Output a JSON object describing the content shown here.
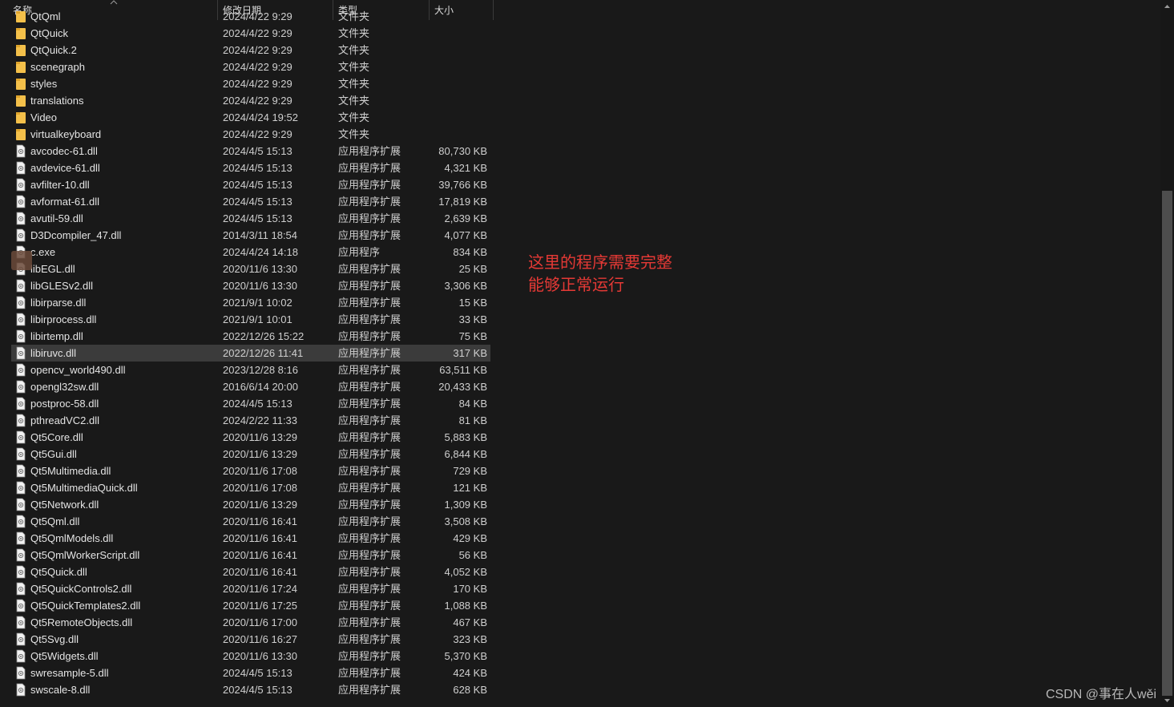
{
  "header": {
    "name": "名称",
    "date": "修改日期",
    "type": "类型",
    "size": "大小"
  },
  "rows": [
    {
      "name": "QtQml",
      "date": "2024/4/22 9:29",
      "type": "文件夹",
      "size": "",
      "kind": "folder"
    },
    {
      "name": "QtQuick",
      "date": "2024/4/22 9:29",
      "type": "文件夹",
      "size": "",
      "kind": "folder"
    },
    {
      "name": "QtQuick.2",
      "date": "2024/4/22 9:29",
      "type": "文件夹",
      "size": "",
      "kind": "folder"
    },
    {
      "name": "scenegraph",
      "date": "2024/4/22 9:29",
      "type": "文件夹",
      "size": "",
      "kind": "folder"
    },
    {
      "name": "styles",
      "date": "2024/4/22 9:29",
      "type": "文件夹",
      "size": "",
      "kind": "folder"
    },
    {
      "name": "translations",
      "date": "2024/4/22 9:29",
      "type": "文件夹",
      "size": "",
      "kind": "folder"
    },
    {
      "name": "Video",
      "date": "2024/4/24 19:52",
      "type": "文件夹",
      "size": "",
      "kind": "folder"
    },
    {
      "name": "virtualkeyboard",
      "date": "2024/4/22 9:29",
      "type": "文件夹",
      "size": "",
      "kind": "folder"
    },
    {
      "name": "avcodec-61.dll",
      "date": "2024/4/5 15:13",
      "type": "应用程序扩展",
      "size": "80,730 KB",
      "kind": "dll"
    },
    {
      "name": "avdevice-61.dll",
      "date": "2024/4/5 15:13",
      "type": "应用程序扩展",
      "size": "4,321 KB",
      "kind": "dll"
    },
    {
      "name": "avfilter-10.dll",
      "date": "2024/4/5 15:13",
      "type": "应用程序扩展",
      "size": "39,766 KB",
      "kind": "dll"
    },
    {
      "name": "avformat-61.dll",
      "date": "2024/4/5 15:13",
      "type": "应用程序扩展",
      "size": "17,819 KB",
      "kind": "dll"
    },
    {
      "name": "avutil-59.dll",
      "date": "2024/4/5 15:13",
      "type": "应用程序扩展",
      "size": "2,639 KB",
      "kind": "dll"
    },
    {
      "name": "D3Dcompiler_47.dll",
      "date": "2014/3/11 18:54",
      "type": "应用程序扩展",
      "size": "4,077 KB",
      "kind": "dll"
    },
    {
      "name": "c.exe",
      "date": "2024/4/24 14:18",
      "type": "应用程序",
      "size": "834 KB",
      "kind": "exe"
    },
    {
      "name": "libEGL.dll",
      "date": "2020/11/6 13:30",
      "type": "应用程序扩展",
      "size": "25 KB",
      "kind": "dll"
    },
    {
      "name": "libGLESv2.dll",
      "date": "2020/11/6 13:30",
      "type": "应用程序扩展",
      "size": "3,306 KB",
      "kind": "dll"
    },
    {
      "name": "libirparse.dll",
      "date": "2021/9/1 10:02",
      "type": "应用程序扩展",
      "size": "15 KB",
      "kind": "dll"
    },
    {
      "name": "libirprocess.dll",
      "date": "2021/9/1 10:01",
      "type": "应用程序扩展",
      "size": "33 KB",
      "kind": "dll"
    },
    {
      "name": "libirtemp.dll",
      "date": "2022/12/26 15:22",
      "type": "应用程序扩展",
      "size": "75 KB",
      "kind": "dll"
    },
    {
      "name": "libiruvc.dll",
      "date": "2022/12/26 11:41",
      "type": "应用程序扩展",
      "size": "317 KB",
      "kind": "dll",
      "selected": true
    },
    {
      "name": "opencv_world490.dll",
      "date": "2023/12/28 8:16",
      "type": "应用程序扩展",
      "size": "63,511 KB",
      "kind": "dll"
    },
    {
      "name": "opengl32sw.dll",
      "date": "2016/6/14 20:00",
      "type": "应用程序扩展",
      "size": "20,433 KB",
      "kind": "dll"
    },
    {
      "name": "postproc-58.dll",
      "date": "2024/4/5 15:13",
      "type": "应用程序扩展",
      "size": "84 KB",
      "kind": "dll"
    },
    {
      "name": "pthreadVC2.dll",
      "date": "2024/2/22 11:33",
      "type": "应用程序扩展",
      "size": "81 KB",
      "kind": "dll"
    },
    {
      "name": "Qt5Core.dll",
      "date": "2020/11/6 13:29",
      "type": "应用程序扩展",
      "size": "5,883 KB",
      "kind": "dll"
    },
    {
      "name": "Qt5Gui.dll",
      "date": "2020/11/6 13:29",
      "type": "应用程序扩展",
      "size": "6,844 KB",
      "kind": "dll"
    },
    {
      "name": "Qt5Multimedia.dll",
      "date": "2020/11/6 17:08",
      "type": "应用程序扩展",
      "size": "729 KB",
      "kind": "dll"
    },
    {
      "name": "Qt5MultimediaQuick.dll",
      "date": "2020/11/6 17:08",
      "type": "应用程序扩展",
      "size": "121 KB",
      "kind": "dll"
    },
    {
      "name": "Qt5Network.dll",
      "date": "2020/11/6 13:29",
      "type": "应用程序扩展",
      "size": "1,309 KB",
      "kind": "dll"
    },
    {
      "name": "Qt5Qml.dll",
      "date": "2020/11/6 16:41",
      "type": "应用程序扩展",
      "size": "3,508 KB",
      "kind": "dll"
    },
    {
      "name": "Qt5QmlModels.dll",
      "date": "2020/11/6 16:41",
      "type": "应用程序扩展",
      "size": "429 KB",
      "kind": "dll"
    },
    {
      "name": "Qt5QmlWorkerScript.dll",
      "date": "2020/11/6 16:41",
      "type": "应用程序扩展",
      "size": "56 KB",
      "kind": "dll"
    },
    {
      "name": "Qt5Quick.dll",
      "date": "2020/11/6 16:41",
      "type": "应用程序扩展",
      "size": "4,052 KB",
      "kind": "dll"
    },
    {
      "name": "Qt5QuickControls2.dll",
      "date": "2020/11/6 17:24",
      "type": "应用程序扩展",
      "size": "170 KB",
      "kind": "dll"
    },
    {
      "name": "Qt5QuickTemplates2.dll",
      "date": "2020/11/6 17:25",
      "type": "应用程序扩展",
      "size": "1,088 KB",
      "kind": "dll"
    },
    {
      "name": "Qt5RemoteObjects.dll",
      "date": "2020/11/6 17:00",
      "type": "应用程序扩展",
      "size": "467 KB",
      "kind": "dll"
    },
    {
      "name": "Qt5Svg.dll",
      "date": "2020/11/6 16:27",
      "type": "应用程序扩展",
      "size": "323 KB",
      "kind": "dll"
    },
    {
      "name": "Qt5Widgets.dll",
      "date": "2020/11/6 13:30",
      "type": "应用程序扩展",
      "size": "5,370 KB",
      "kind": "dll"
    },
    {
      "name": "swresample-5.dll",
      "date": "2024/4/5 15:13",
      "type": "应用程序扩展",
      "size": "424 KB",
      "kind": "dll"
    },
    {
      "name": "swscale-8.dll",
      "date": "2024/4/5 15:13",
      "type": "应用程序扩展",
      "size": "628 KB",
      "kind": "dll"
    }
  ],
  "annotation": {
    "line1": "这里的程序需要完整",
    "line2": "能够正常运行",
    "color": "#e53935"
  },
  "watermark": "CSDN @事在人wěi",
  "icons": {
    "folder": "folder-icon",
    "dll": "dll-file-icon",
    "exe": "exe-file-icon",
    "sort": "sort-ascending-icon"
  }
}
